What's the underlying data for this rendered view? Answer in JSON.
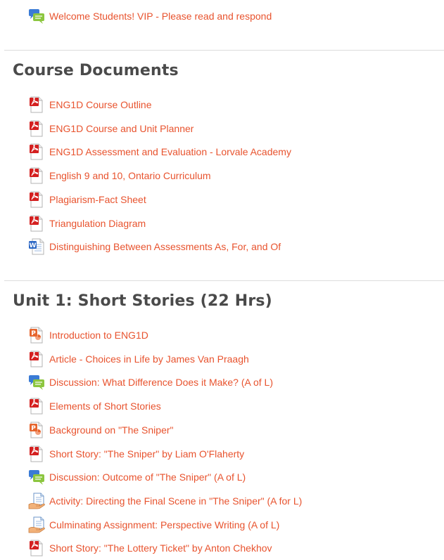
{
  "sections": [
    {
      "title": "",
      "activities": [
        {
          "icon": "forum-icon",
          "label": "Welcome Students! VIP - Please read and respond"
        }
      ]
    },
    {
      "title": "Course Documents",
      "activities": [
        {
          "icon": "pdf-icon",
          "label": "ENG1D Course Outline"
        },
        {
          "icon": "pdf-icon",
          "label": "ENG1D Course and Unit Planner"
        },
        {
          "icon": "pdf-icon",
          "label": "ENG1D Assessment and Evaluation - Lorvale Academy"
        },
        {
          "icon": "pdf-icon",
          "label": "English 9 and 10, Ontario Curriculum"
        },
        {
          "icon": "pdf-icon",
          "label": "Plagiarism-Fact Sheet"
        },
        {
          "icon": "pdf-icon",
          "label": "Triangulation Diagram"
        },
        {
          "icon": "word-doc-icon",
          "label": "Distinguishing Between Assessments As, For, and Of"
        }
      ]
    },
    {
      "title": "Unit 1: Short Stories (22 Hrs)",
      "activities": [
        {
          "icon": "powerpoint-icon",
          "label": "Introduction to ENG1D"
        },
        {
          "icon": "pdf-icon",
          "label": "Article - Choices in Life by James Van Praagh"
        },
        {
          "icon": "forum-icon",
          "label": "Discussion: What Difference Does it Make? (A of L)"
        },
        {
          "icon": "pdf-icon",
          "label": "Elements of Short Stories"
        },
        {
          "icon": "powerpoint-icon",
          "label": "Background on \"The Sniper\""
        },
        {
          "icon": "pdf-icon",
          "label": "Short Story: \"The Sniper\" by Liam O'Flaherty"
        },
        {
          "icon": "forum-icon",
          "label": "Discussion: Outcome of \"The Sniper\" (A of L)"
        },
        {
          "icon": "assignment-icon",
          "label": "Activity: Directing the Final Scene in \"The Sniper\" (A for L)"
        },
        {
          "icon": "assignment-icon",
          "label": "Culminating Assignment: Perspective Writing (A of L)"
        },
        {
          "icon": "pdf-icon",
          "label": "Short Story: \"The Lottery Ticket\" by Anton Chekhov"
        }
      ]
    }
  ],
  "colors": {
    "link": "#e8532e",
    "heading": "#4a4a4a",
    "divider": "#dcdcdc"
  }
}
